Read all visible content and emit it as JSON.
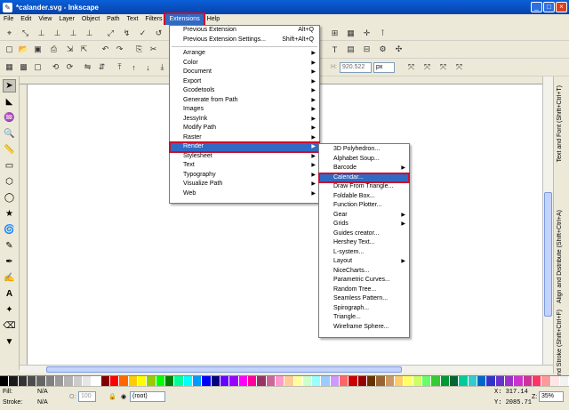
{
  "window": {
    "title": "*calander.svg - Inkscape",
    "min": "_",
    "max": "□",
    "close": "×"
  },
  "menubar": [
    "File",
    "Edit",
    "View",
    "Layer",
    "Object",
    "Path",
    "Text",
    "Filters",
    "Extensions",
    "Help"
  ],
  "toolbar": {
    "w_value": "920.522",
    "unit": "px"
  },
  "extensions_menu": {
    "top_items": [
      {
        "label": "Previous Extension",
        "accel": "Alt+Q"
      },
      {
        "label": "Previous Extension Settings...",
        "accel": "Shift+Alt+Q"
      }
    ],
    "submenus": [
      "Arrange",
      "Color",
      "Document",
      "Export",
      "Gcodetools",
      "Generate from Path",
      "Images",
      "JessyInk",
      "Modify Path",
      "Raster",
      "Render",
      "Stylesheet",
      "Text",
      "Typography",
      "Visualize Path",
      "Web"
    ],
    "highlighted": "Render"
  },
  "render_menu": {
    "items": [
      "3D Polyhedron...",
      "Alphabet Soup...",
      "Barcode",
      "Calendar...",
      "Draw From Triangle...",
      "Foldable Box...",
      "Function Plotter...",
      "Gear",
      "Grids",
      "Guides creator...",
      "Hershey Text...",
      "L-system...",
      "Layout",
      "NiceCharts...",
      "Parametric Curves...",
      "Random Tree...",
      "Seamless Pattern...",
      "Spirograph...",
      "Triangle...",
      "Wireframe Sphere..."
    ],
    "has_submenu": [
      "Barcode",
      "Gear",
      "Grids",
      "Layout"
    ],
    "highlighted": "Calendar..."
  },
  "dock_tabs": [
    "Text and Font (Shift+Ctrl+T)",
    "Align and Distribute (Shift+Ctrl+A)",
    "Fill and Stroke (Shift+Ctrl+F)"
  ],
  "status": {
    "fill_label": "Fill:",
    "fill_value": "N/A",
    "stroke_label": "Stroke:",
    "stroke_value": "N/A",
    "opacity_label": "O:",
    "opacity_value": "100",
    "layer": "(root)",
    "x_readout": "X: 317.14",
    "y_readout": "Y: 2085.71",
    "zoom_label": "Z:",
    "zoom_value": "35%"
  },
  "palette_colors": [
    "#000000",
    "#1a1a1a",
    "#333333",
    "#4d4d4d",
    "#666666",
    "#808080",
    "#999999",
    "#b3b3b3",
    "#cccccc",
    "#e6e6e6",
    "#ffffff",
    "#800000",
    "#ff0000",
    "#ff6600",
    "#ffcc00",
    "#ffff00",
    "#99cc00",
    "#00ff00",
    "#008000",
    "#00ff99",
    "#00ffff",
    "#0099ff",
    "#0000ff",
    "#000080",
    "#6600ff",
    "#9900ff",
    "#ff00ff",
    "#ff0099",
    "#993366",
    "#cc6699",
    "#ff99cc",
    "#ffcc99",
    "#ffff99",
    "#ccffcc",
    "#99ffff",
    "#99ccff",
    "#cc99ff",
    "#ff6666",
    "#cc0000",
    "#990000",
    "#663300",
    "#996633",
    "#cc9966",
    "#ffcc66",
    "#ffff66",
    "#ccff66",
    "#66ff66",
    "#33cc33",
    "#009933",
    "#006633",
    "#00cc99",
    "#33cccc",
    "#0066cc",
    "#3333cc",
    "#6633cc",
    "#9933cc",
    "#cc33cc",
    "#cc3399",
    "#ff3366",
    "#ff9999",
    "#ffe5e5",
    "#f2f2f2"
  ]
}
